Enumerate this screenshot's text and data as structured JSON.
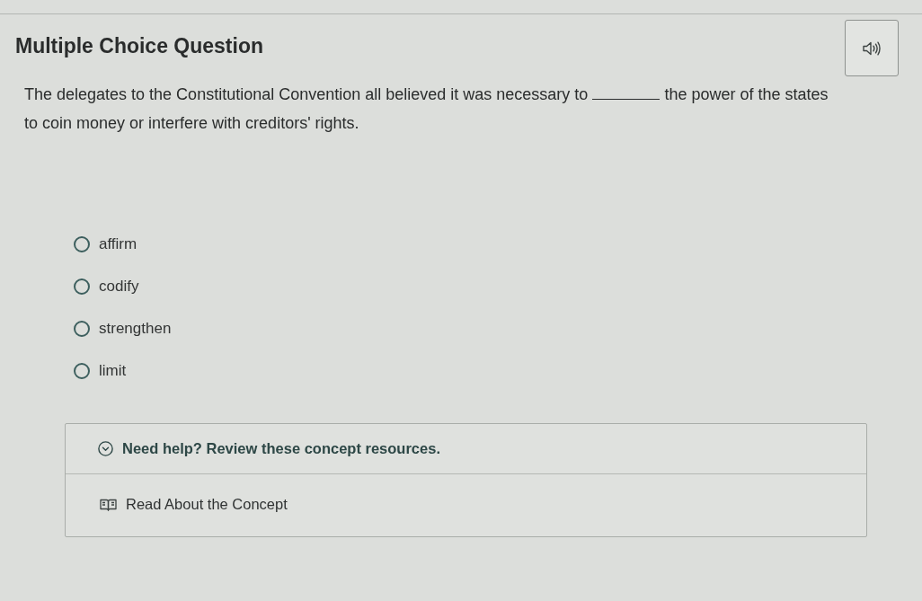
{
  "title": "Multiple Choice Question",
  "question": {
    "text_before_blank": "The delegates to the Constitutional Convention all believed it was necessary to",
    "text_after_blank": "the power of the states to coin money or interfere with creditors' rights."
  },
  "options": [
    {
      "label": "affirm",
      "selected": false
    },
    {
      "label": "codify",
      "selected": false
    },
    {
      "label": "strengthen",
      "selected": false
    },
    {
      "label": "limit",
      "selected": false
    }
  ],
  "help": {
    "heading": "Need help? Review these concept resources.",
    "expanded": true,
    "resources": [
      "Read About the Concept"
    ]
  }
}
